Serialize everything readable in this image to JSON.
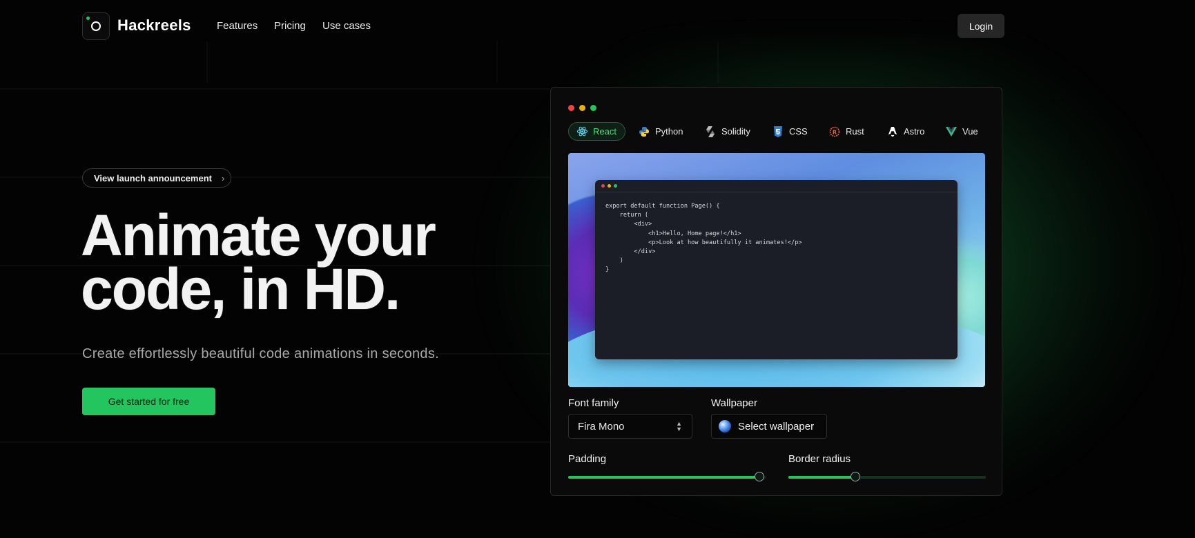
{
  "header": {
    "brand": "Hackreels",
    "nav": [
      "Features",
      "Pricing",
      "Use cases"
    ],
    "login_label": "Login"
  },
  "hero": {
    "announcement": "View launch announcement",
    "announcement_chevron": "›",
    "title_line1": "Animate your",
    "title_line2": "code, in HD.",
    "subtitle": "Create effortlessly beautiful code animations in seconds.",
    "cta_label": "Get started for free"
  },
  "editor": {
    "tabs": [
      {
        "label": "React",
        "icon": "react-icon",
        "color": "#61dafb",
        "active": true
      },
      {
        "label": "Python",
        "icon": "python-icon",
        "color": "#f7d13c",
        "active": false
      },
      {
        "label": "Solidity",
        "icon": "solidity-icon",
        "color": "#cfcfcf",
        "active": false
      },
      {
        "label": "CSS",
        "icon": "css-icon",
        "color": "#2f7ed8",
        "active": false
      },
      {
        "label": "Rust",
        "icon": "rust-icon",
        "color": "#e8673b",
        "active": false
      },
      {
        "label": "Astro",
        "icon": "astro-icon",
        "color": "#ffffff",
        "active": false
      },
      {
        "label": "Vue",
        "icon": "vue-icon",
        "color": "#41b883",
        "active": false
      }
    ],
    "code_lines": [
      "export default function Page() {",
      "    return (",
      "        <div>",
      "            <h1>Hello, Home page!</h1>",
      "            <p>Look at how beautifully it animates!</p>",
      "        </div>",
      "    )",
      "}"
    ],
    "font_family_label": "Font family",
    "font_family_value": "Fira Mono",
    "wallpaper_label": "Wallpaper",
    "wallpaper_button": "Select wallpaper",
    "padding_label": "Padding",
    "padding_level": 0.97,
    "border_radius_label": "Border radius",
    "border_radius_level": 0.34
  },
  "colors": {
    "accent": "#22c55e",
    "background": "#030303",
    "traffic_red": "#ef4444",
    "traffic_yellow": "#eab308",
    "traffic_green": "#22c55e"
  }
}
